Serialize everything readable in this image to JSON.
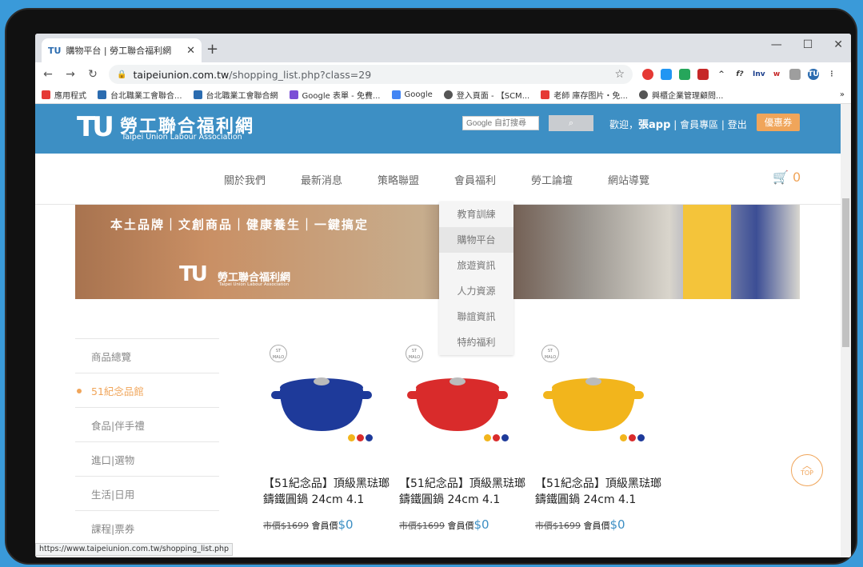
{
  "browser": {
    "tab_title": "購物平台 | 勞工聯合福利網",
    "tab_favicon": "TU",
    "url_host": "taipeiunion.com.tw",
    "url_path": "/shopping_list.php?class=29",
    "status_url": "https://www.taipeiunion.com.tw/shopping_list.php",
    "bookmarks": [
      "應用程式",
      "台北職業工會聯合...",
      "台北職業工會聯合網",
      "Google 表單 - 免費...",
      "Google",
      "登入頁面 - 【SCM...",
      "老師 庫存图片・免...",
      "興櫃企業管理顧問..."
    ],
    "bookmark_colors": [
      "#e53935",
      "#2b6cb0",
      "#2b6cb0",
      "#7b4fd6",
      "#4285f4",
      "#555555",
      "#e53935",
      "#555555"
    ]
  },
  "header": {
    "logo": "TU",
    "title": "勞工聯合福利網",
    "subtitle": "Taipei Union Labour Association",
    "search_placeholder": "Google 自訂搜尋",
    "welcome_prefix": "歡迎，",
    "user": "張app",
    "links": " | 會員專區 | 登出",
    "coupon": "優惠券"
  },
  "nav": {
    "items": [
      "關於我們",
      "最新消息",
      "策略聯盟",
      "會員福利",
      "勞工論壇",
      "網站導覽"
    ],
    "cart_count": "0"
  },
  "dropdown": [
    "教育訓練",
    "購物平台",
    "旅遊資訊",
    "人力資源",
    "聯誼資訊",
    "特約福利"
  ],
  "banner": {
    "slogan": "本土品牌｜文創商品｜健康養生｜一鍵搞定",
    "logo": "TU",
    "title": "勞工聯合福利網",
    "subtitle": "Taipei Union Labour Association"
  },
  "sidebar": [
    "商品總覽",
    "51紀念品館",
    "食品|伴手禮",
    "進口|選物",
    "生活|日用",
    "課程|票券"
  ],
  "products": [
    {
      "badge": "ST MALO",
      "name": "【51紀念品】頂級黑琺瑯鑄鐵圓鍋 24cm 4.1",
      "list_price": "市價$1699",
      "member_label": "會員價",
      "member_price": "$0",
      "color": "#1e3a9a"
    },
    {
      "badge": "ST MALO",
      "name": "【51紀念品】頂級黑琺瑯鑄鐵圓鍋 24cm 4.1",
      "list_price": "市價$1699",
      "member_label": "會員價",
      "member_price": "$0",
      "color": "#d92b2b"
    },
    {
      "badge": "ST MALO",
      "name": "【51紀念品】頂級黑琺瑯鑄鐵圓鍋 24cm 4.1",
      "list_price": "市價$1699",
      "member_label": "會員價",
      "member_price": "$0",
      "color": "#f2b51c"
    }
  ],
  "swatch_colors": [
    "#f2b51c",
    "#d92b2b",
    "#1e3a9a"
  ],
  "top_button": "TOP"
}
